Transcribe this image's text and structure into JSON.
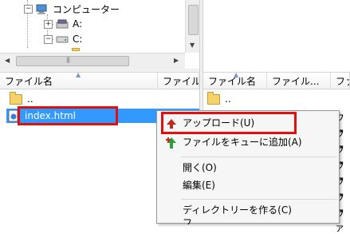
{
  "tree": {
    "computer_label": "コンピューター",
    "drive_a_label": "A:",
    "drive_c_label": "C:",
    "expander_plus": "+",
    "expander_minus": "−"
  },
  "left_list": {
    "columns": [
      "ファイル名",
      "ファイル"
    ],
    "rows": [
      {
        "name": ".."
      },
      {
        "name": "index.html"
      }
    ]
  },
  "right_list": {
    "columns": [
      "ファイル名",
      "ファイル...",
      "ファ"
    ],
    "rows": [
      {
        "name": ".."
      }
    ],
    "type_cells": [
      "ファ",
      "ファ",
      "ファ",
      "ファ",
      "ファ",
      "ファ",
      "ファ"
    ]
  },
  "context_menu": {
    "upload": "アップロード(U)",
    "add_queue": "ファイルをキューに追加(A)",
    "open": "開く(O)",
    "edit": "編集(E)",
    "mkdir": "ディレクトリーを作る(C)",
    "partial": "フ..."
  },
  "colors": {
    "selection": "#3399ff",
    "highlight_box": "#e01010",
    "upload_arrow": "#c0281c",
    "queue_arrow": "#2e9d3a"
  },
  "icons": {
    "upload": "red-up-arrow",
    "add_queue": "green-up-red-plus",
    "folder": "folder-icon",
    "html_file": "web-file-icon"
  }
}
